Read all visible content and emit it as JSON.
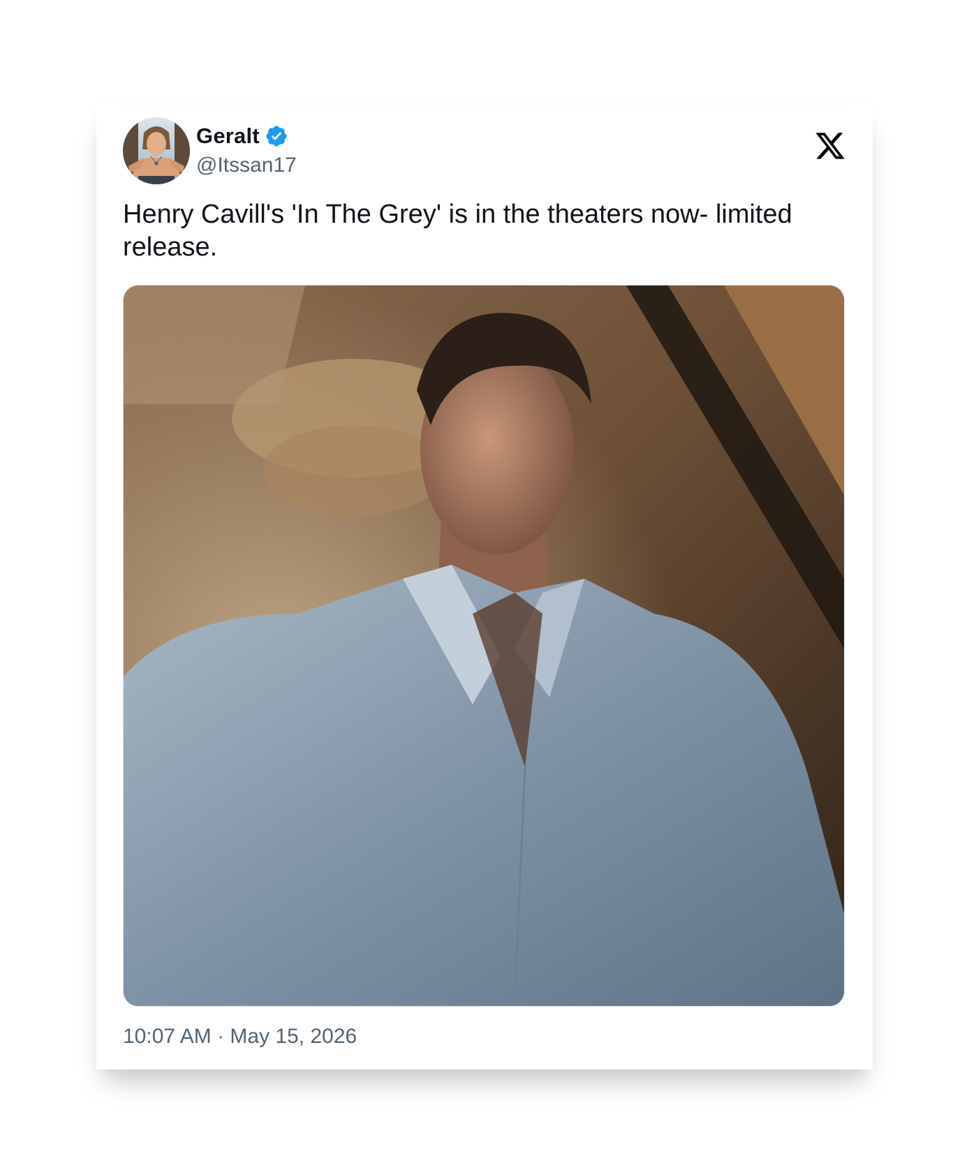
{
  "author": {
    "display_name": "Geralt",
    "handle": "@Itssan17",
    "verified": true,
    "verified_color": "#1d9bf0",
    "avatar_icon": "avatar-illustration"
  },
  "brand": {
    "logo_icon": "x-logo-icon"
  },
  "tweet": {
    "text": "Henry Cavill's 'In The Grey' is in the theaters now- limited release.",
    "media_description_icon": "photo",
    "timestamp": "10:07 AM · May 15, 2026"
  },
  "colors": {
    "text_primary": "#0f1419",
    "text_secondary": "#536471",
    "background": "#ffffff"
  }
}
